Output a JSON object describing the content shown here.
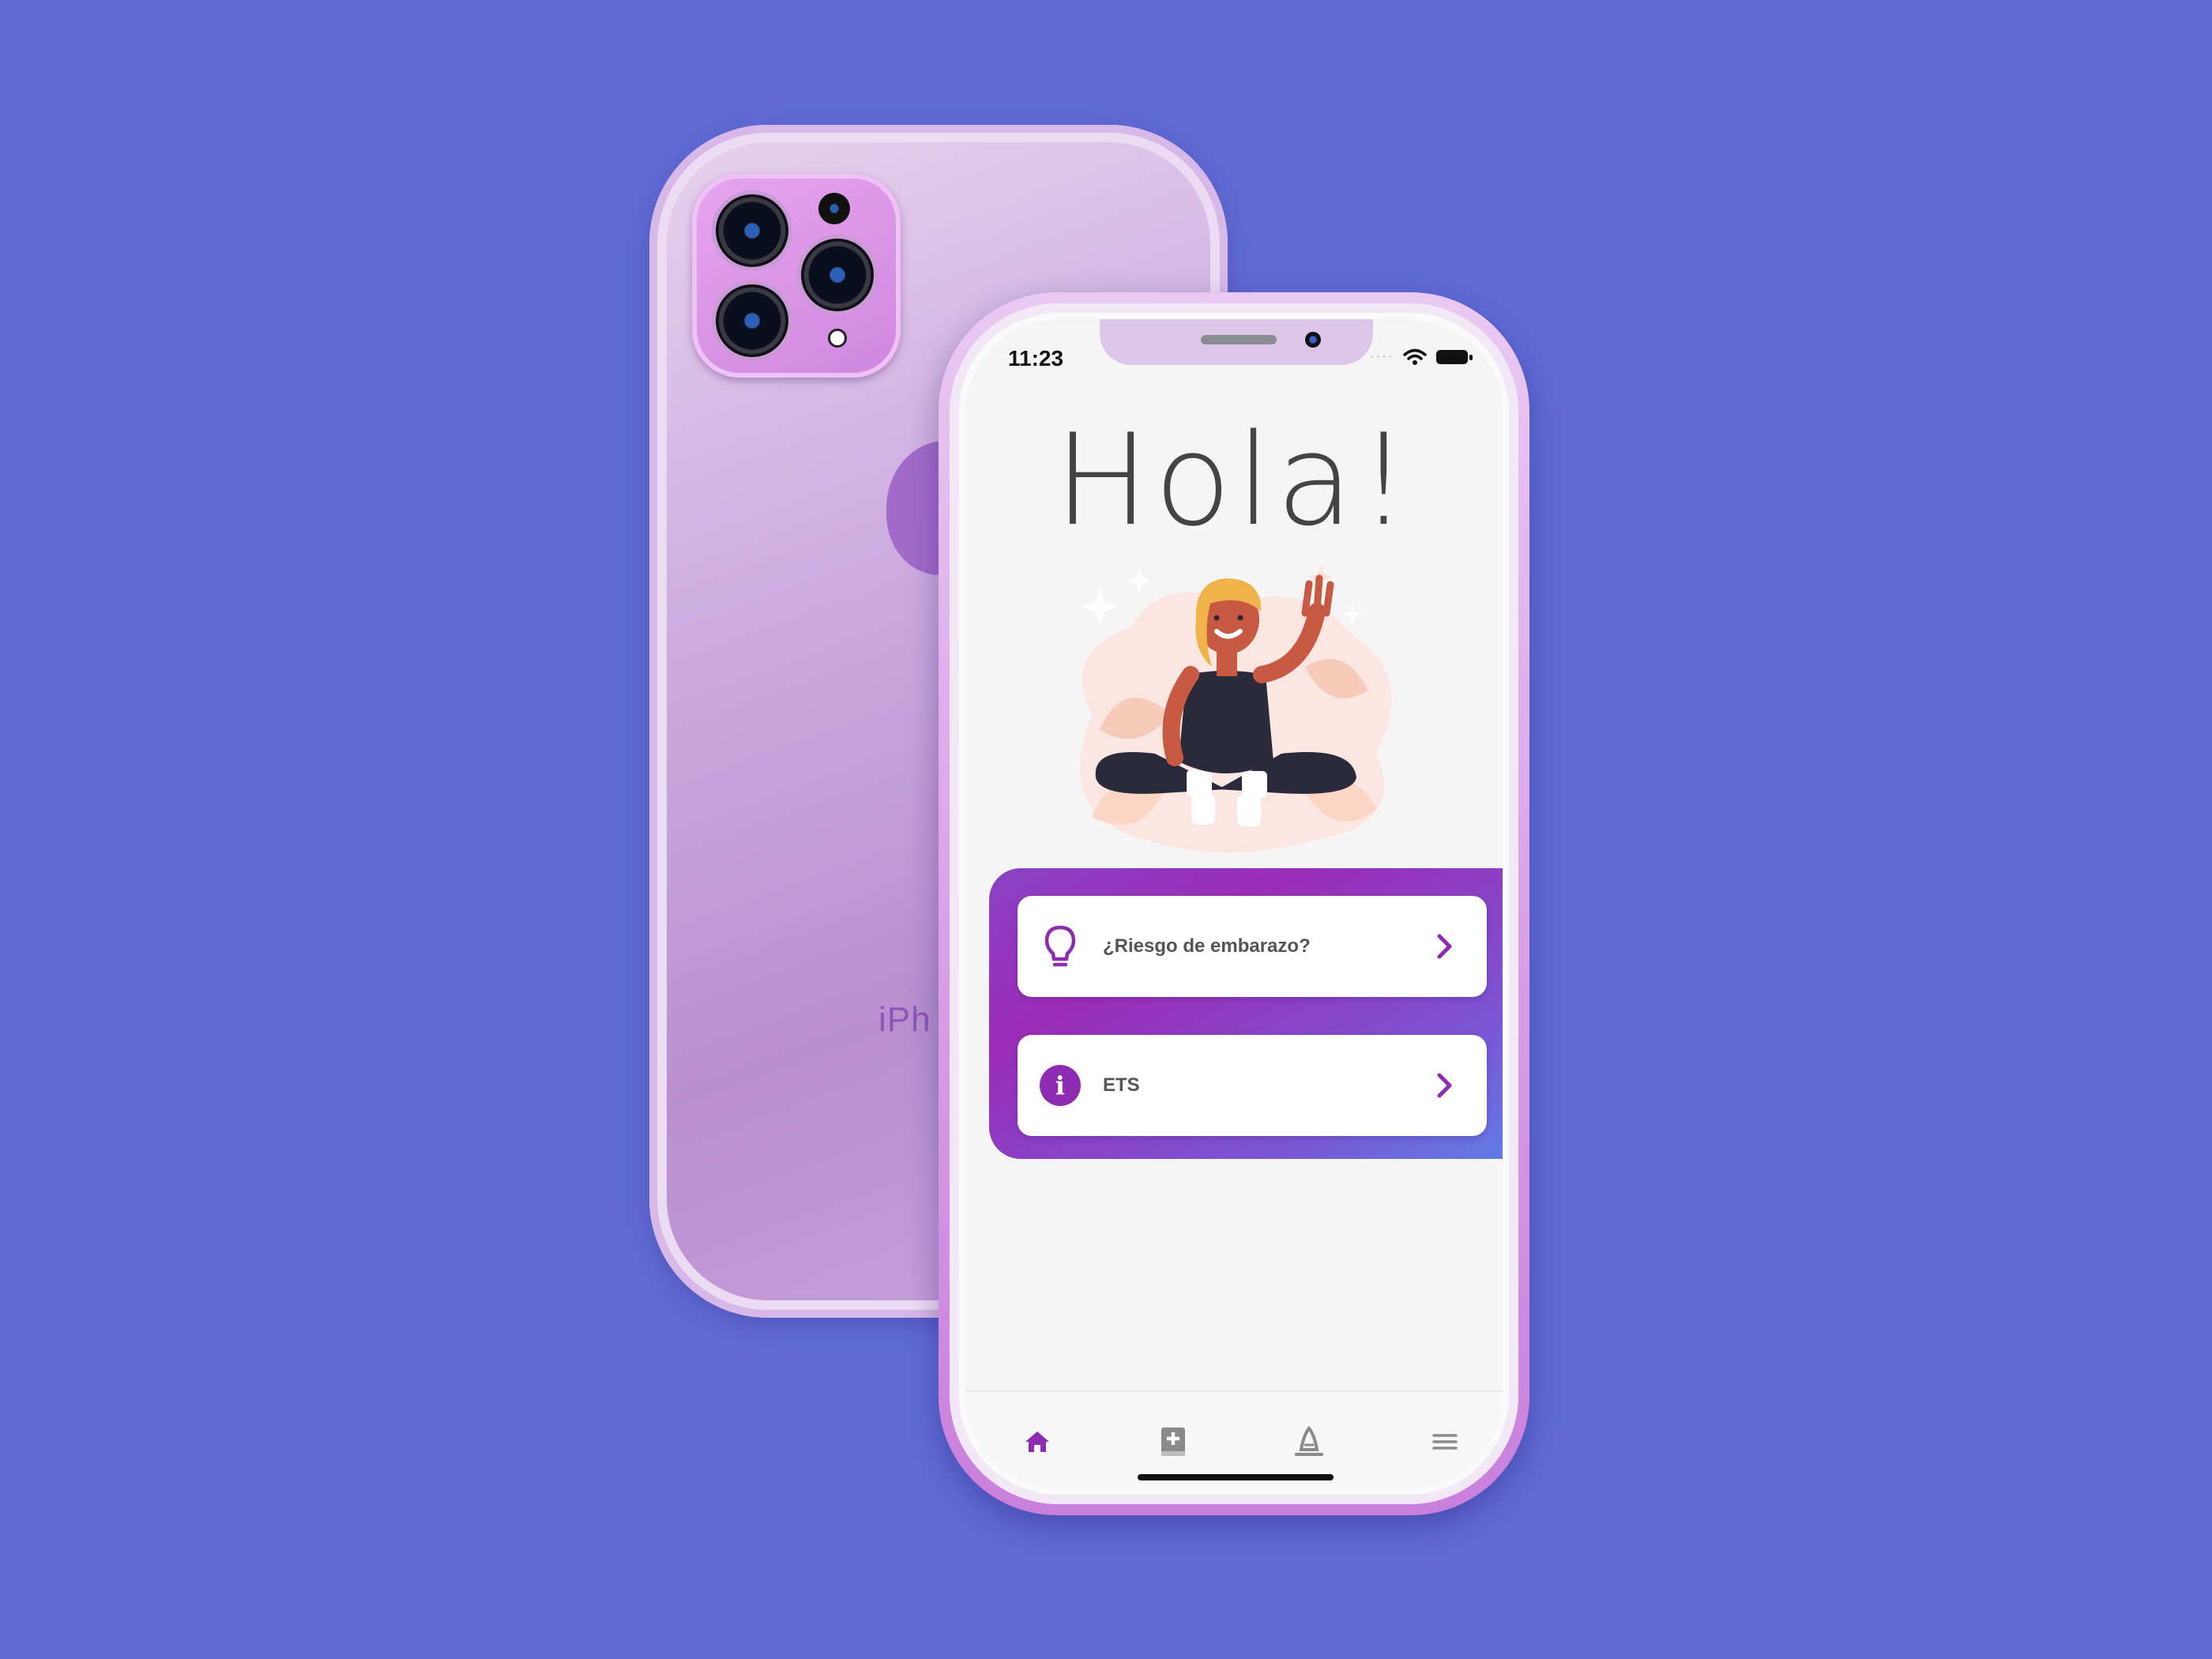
{
  "status_bar": {
    "time": "11:23",
    "dots": "····"
  },
  "back_phone": {
    "label": "iPh"
  },
  "home": {
    "greeting": "Hola!",
    "cards": [
      {
        "label": "¿Riesgo de embarazo?",
        "icon": "lightbulb-icon"
      },
      {
        "label": "ETS",
        "icon": "info-icon",
        "icon_text": "i"
      }
    ]
  },
  "tab_bar": {
    "items": [
      {
        "icon": "home-icon",
        "active": true
      },
      {
        "icon": "medical-book-icon",
        "active": false
      },
      {
        "icon": "condom-icon",
        "active": false
      },
      {
        "icon": "menu-icon",
        "active": false
      }
    ]
  },
  "colors": {
    "background": "#606bd6",
    "accent": "#8e2bb3",
    "panel_gradient_start": "#8a43c6",
    "panel_gradient_end": "#5f7fe6",
    "inactive_icon": "#8a8a8a"
  }
}
